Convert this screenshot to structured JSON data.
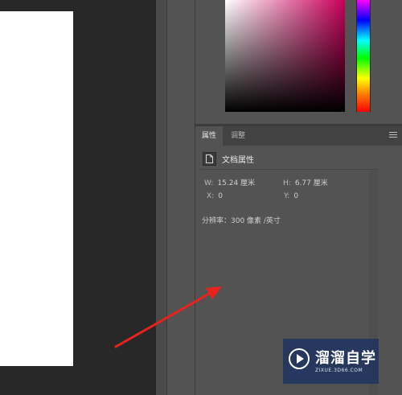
{
  "properties_panel": {
    "tabs": [
      {
        "label": "属性",
        "active": true
      },
      {
        "label": "调整",
        "active": false
      }
    ],
    "menu_icon": "hamburger-icon",
    "doc_icon": "document-icon",
    "title": "文档属性",
    "width": {
      "label": "W:",
      "value": "15.24 厘米"
    },
    "height": {
      "label": "H:",
      "value": "6.77 厘米"
    },
    "x": {
      "label": "X:",
      "value": "0"
    },
    "y": {
      "label": "Y:",
      "value": "0"
    },
    "resolution": "分辨率：300 像素 /英寸"
  },
  "color_picker": {
    "hue_color": "#c8005a"
  },
  "watermark": {
    "text": "溜溜自学",
    "url": "ZIXUE.3D66.COM"
  },
  "annotation": {
    "arrow_color": "#e8231e"
  }
}
